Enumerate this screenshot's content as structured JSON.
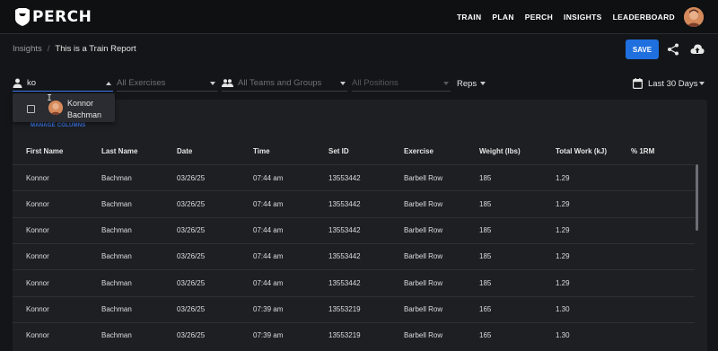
{
  "brand": {
    "name": "PERCH"
  },
  "nav": {
    "items": [
      "TRAIN",
      "PLAN",
      "PERCH",
      "INSIGHTS",
      "LEADERBOARD"
    ]
  },
  "breadcrumb": {
    "parent": "Insights",
    "separator": "/",
    "current": "This is a Train Report"
  },
  "toolbar": {
    "save_label": "SAVE",
    "share_icon": "share-icon",
    "upload_icon": "cloud-upload-icon"
  },
  "filters": {
    "athlete_value": "ko",
    "exercises_placeholder": "All Exercises",
    "teams_placeholder": "All Teams and Groups",
    "positions_placeholder": "All Positions",
    "metric_value": "Reps",
    "date_range": "Last 30 Days"
  },
  "dropdown": {
    "first_name": "Konnor",
    "last_name": "Bachman"
  },
  "manage_columns_label": "MANAGE COLUMNS",
  "table": {
    "headers": [
      "First Name",
      "Last Name",
      "Date",
      "Time",
      "Set ID",
      "Exercise",
      "Weight (lbs)",
      "Total Work (kJ)",
      "% 1RM"
    ],
    "rows": [
      [
        "Konnor",
        "Bachman",
        "03/26/25",
        "07:44 am",
        "13553442",
        "Barbell Row",
        "185",
        "1.29",
        ""
      ],
      [
        "Konnor",
        "Bachman",
        "03/26/25",
        "07:44 am",
        "13553442",
        "Barbell Row",
        "185",
        "1.29",
        ""
      ],
      [
        "Konnor",
        "Bachman",
        "03/26/25",
        "07:44 am",
        "13553442",
        "Barbell Row",
        "185",
        "1.29",
        ""
      ],
      [
        "Konnor",
        "Bachman",
        "03/26/25",
        "07:44 am",
        "13553442",
        "Barbell Row",
        "185",
        "1.29",
        ""
      ],
      [
        "Konnor",
        "Bachman",
        "03/26/25",
        "07:44 am",
        "13553442",
        "Barbell Row",
        "185",
        "1.29",
        ""
      ],
      [
        "Konnor",
        "Bachman",
        "03/26/25",
        "07:39 am",
        "13553219",
        "Barbell Row",
        "165",
        "1.30",
        ""
      ],
      [
        "Konnor",
        "Bachman",
        "03/26/25",
        "07:39 am",
        "13553219",
        "Barbell Row",
        "165",
        "1.30",
        ""
      ]
    ]
  },
  "colors": {
    "accent": "#1f6fde",
    "background": "#141518",
    "card": "#1d1f23"
  }
}
